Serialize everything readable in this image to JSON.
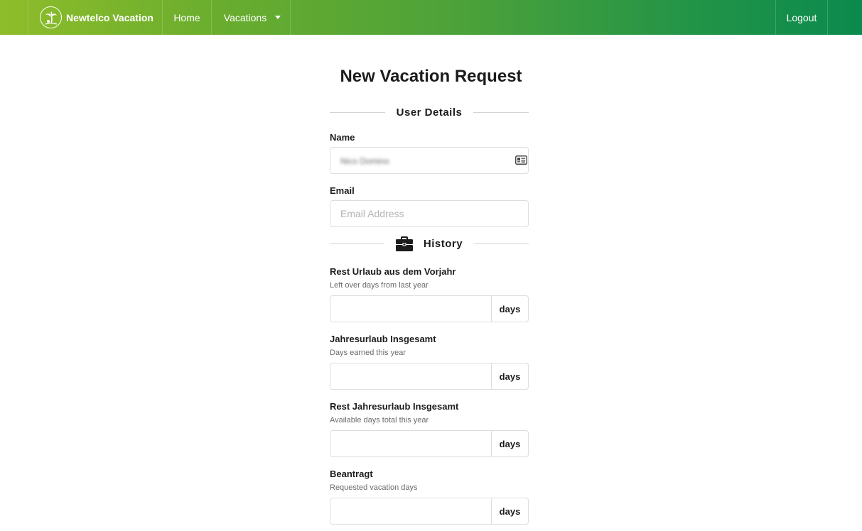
{
  "nav": {
    "brand": "Newtelco Vacation",
    "home": "Home",
    "vacations": "Vacations",
    "logout": "Logout"
  },
  "page": {
    "title": "New Vacation Request"
  },
  "user_details": {
    "heading": "User Details",
    "name_label": "Name",
    "name_value": "Nico Domino",
    "email_label": "Email",
    "email_placeholder": "Email Address"
  },
  "history": {
    "heading": "History",
    "fields": [
      {
        "label": "Rest Urlaub aus dem Vorjahr",
        "hint": "Left over days from last year",
        "unit": "days",
        "value": ""
      },
      {
        "label": "Jahresurlaub Insgesamt",
        "hint": "Days earned this year",
        "unit": "days",
        "value": ""
      },
      {
        "label": "Rest Jahresurlaub Insgesamt",
        "hint": "Available days total this year",
        "unit": "days",
        "value": ""
      },
      {
        "label": "Beantragt",
        "hint": "Requested vacation days",
        "unit": "days",
        "value": ""
      }
    ]
  },
  "icons": {
    "brand": "palm-tree-icon",
    "name_field": "id-card-icon",
    "history": "briefcase-icon",
    "vacations_menu": "caret-down-icon"
  },
  "colors": {
    "nav_gradient_start": "#8fbd2a",
    "nav_gradient_end": "#0b8a4e"
  }
}
